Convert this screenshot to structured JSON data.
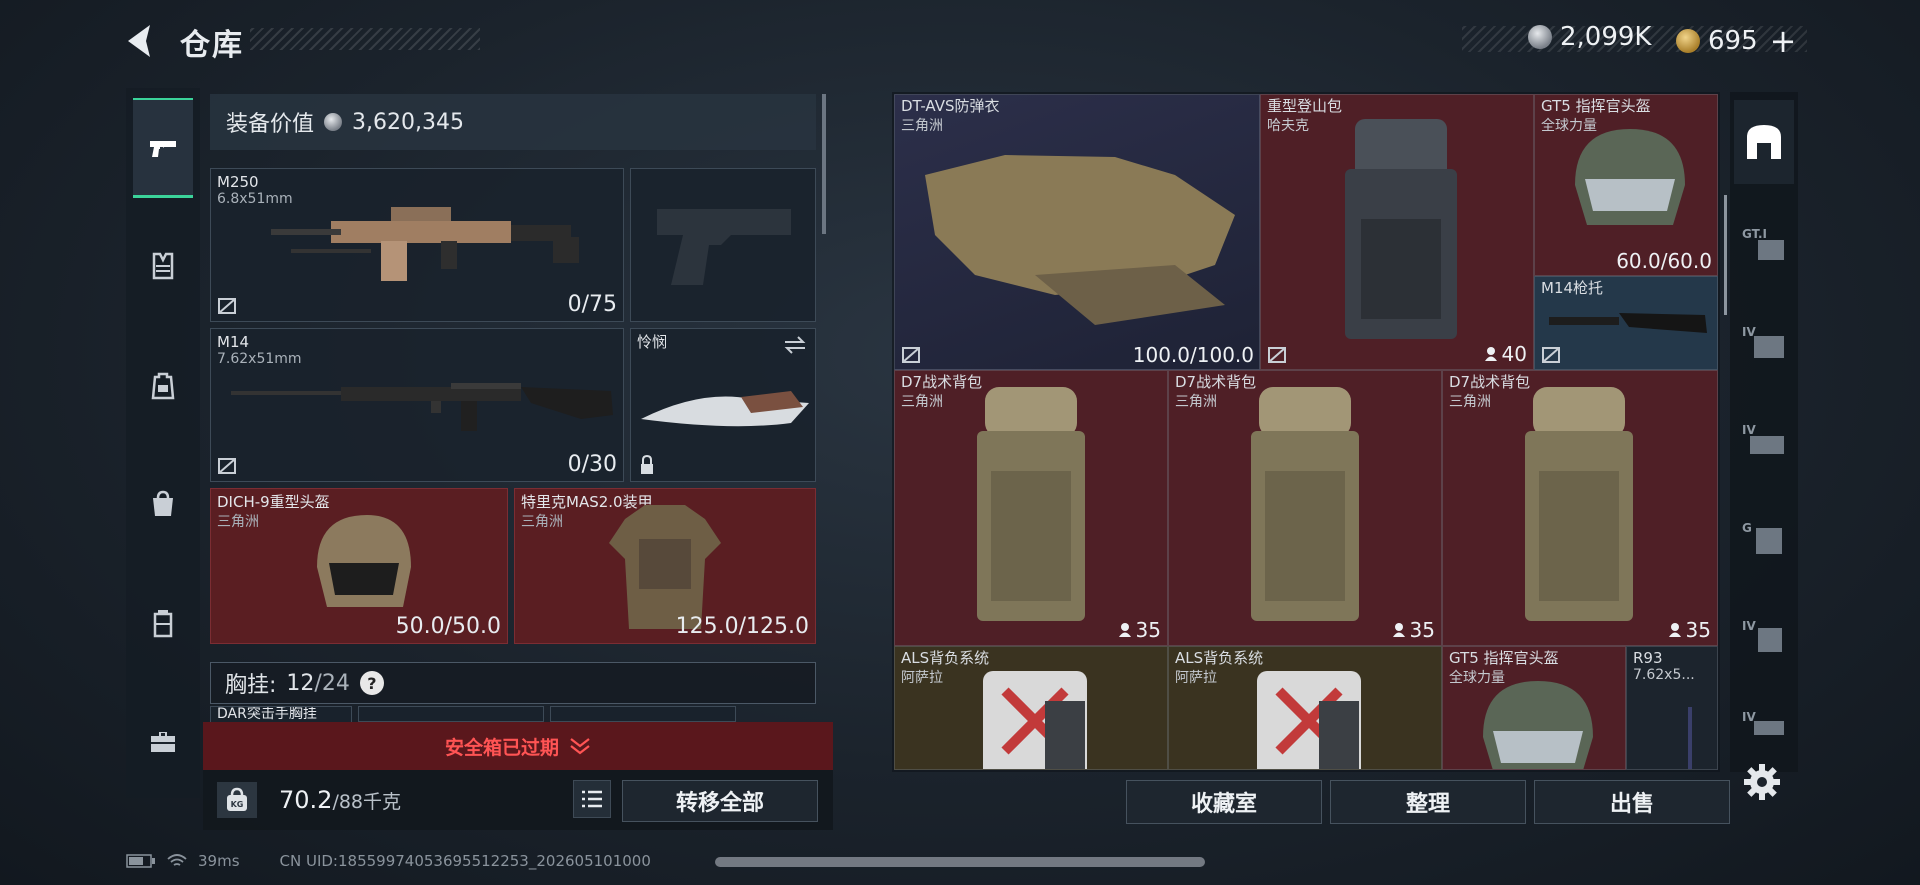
{
  "header": {
    "title": "仓库",
    "currency_silver": "2,099K",
    "currency_gold": "695",
    "add_label": "+"
  },
  "equipment": {
    "value_label": "装备价值",
    "value": "3,620,345",
    "primary_weapon": {
      "name": "M250",
      "caliber": "6.8x51mm",
      "ammo": "0/75"
    },
    "secondary_weapon": {
      "name": "M14",
      "caliber": "7.62x51mm",
      "ammo": "0/30"
    },
    "melee": {
      "name": "怜悯"
    },
    "helmet": {
      "name": "DICH-9重型头盔",
      "faction": "三角洲",
      "durability": "50.0/50.0"
    },
    "armor": {
      "name": "特里克MAS2.0装甲",
      "faction": "三角洲",
      "durability": "125.0/125.0"
    },
    "chest_rig_label": "胸挂:",
    "chest_rig_current": "12",
    "chest_rig_max": "/24",
    "help_label": "?",
    "partial_item": "DAR突击手胸挂"
  },
  "safe_box": {
    "expired_text": "安全箱已过期"
  },
  "bottom": {
    "weight_current": "70.2",
    "weight_max": "/88千克",
    "kg_label": "KG",
    "transfer_all": "转移全部"
  },
  "storage": {
    "items": [
      {
        "name": "DT-AVS防弹衣",
        "sub": "三角洲",
        "value": "100.0/100.0"
      },
      {
        "name": "重型登山包",
        "sub": "哈夫克",
        "capacity": "40"
      },
      {
        "name": "GT5 指挥官头盔",
        "sub": "全球力量",
        "value": "60.0/60.0"
      },
      {
        "name": "M14枪托",
        "sub": ""
      },
      {
        "name": "D7战术背包",
        "sub": "三角洲",
        "capacity": "35"
      },
      {
        "name": "D7战术背包",
        "sub": "三角洲",
        "capacity": "35"
      },
      {
        "name": "D7战术背包",
        "sub": "三角洲",
        "capacity": "35"
      },
      {
        "name": "ALS背负系统",
        "sub": "阿萨拉"
      },
      {
        "name": "ALS背负系统",
        "sub": "阿萨拉"
      },
      {
        "name": "GT5 指挥官头盔",
        "sub": "全球力量"
      },
      {
        "name": "R93",
        "sub": "7.62x5..."
      }
    ],
    "buttons": {
      "collection": "收藏室",
      "sort": "整理",
      "sell": "出售"
    }
  },
  "right_tabs": [
    "GT.I",
    "IV",
    "IV",
    "G",
    "IV",
    "IV"
  ],
  "status": {
    "ping": "39ms",
    "uid": "CN UID:18559974053695512253_202605101000"
  },
  "colors": {
    "accent_green": "#3bd39a",
    "expired_red": "#ff5454",
    "maroon_cell": "#4f1f26",
    "navy_cell": "#2c2f4a"
  }
}
